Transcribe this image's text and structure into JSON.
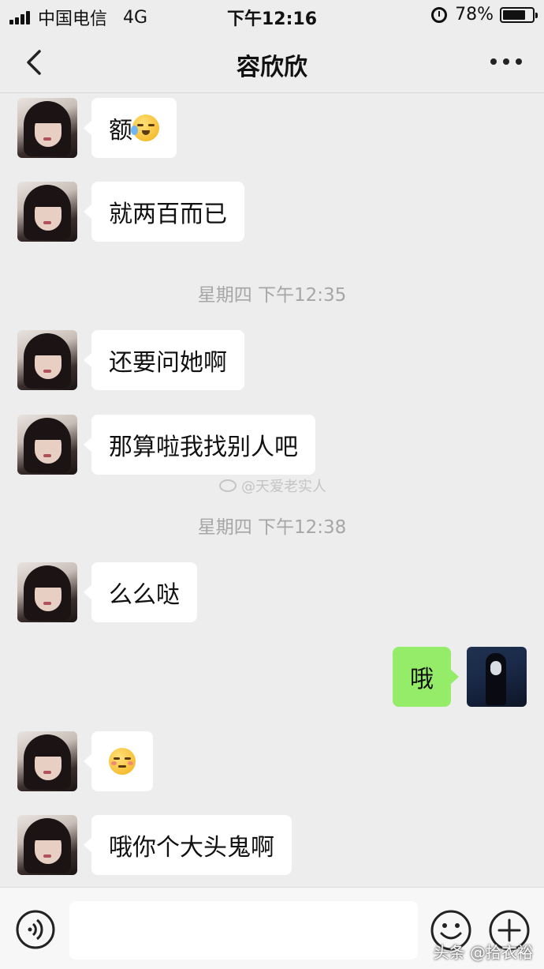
{
  "status_bar": {
    "carrier": "中国电信",
    "network": "4G",
    "time": "下午12:16",
    "battery": "78%",
    "battery_level": 0.78
  },
  "header": {
    "title": "容欣欣"
  },
  "messages": [
    {
      "side": "left",
      "text": "额",
      "emoji": "crying-laughing-face"
    },
    {
      "side": "left",
      "text": "就两百而已"
    },
    {
      "type": "timestamp",
      "text": "星期四 下午12:35"
    },
    {
      "side": "left",
      "text": "还要问她啊"
    },
    {
      "side": "left",
      "text": "那算啦我找别人吧"
    },
    {
      "type": "watermark",
      "text": "@天爱老实人"
    },
    {
      "type": "timestamp",
      "text": "星期四 下午12:38"
    },
    {
      "side": "left",
      "text": "么么哒"
    },
    {
      "side": "right",
      "text": "哦"
    },
    {
      "side": "left",
      "text": "",
      "emoji": "blushing-face"
    },
    {
      "side": "left",
      "text": "哦你个大头鬼啊"
    }
  ],
  "input_bar": {
    "placeholder": "",
    "footer_watermark": "头条 @拾衣裕"
  },
  "colors": {
    "background": "#ededed",
    "incoming_bubble": "#ffffff",
    "outgoing_bubble": "#95ec69",
    "timestamp_text": "#a6a6a6"
  }
}
